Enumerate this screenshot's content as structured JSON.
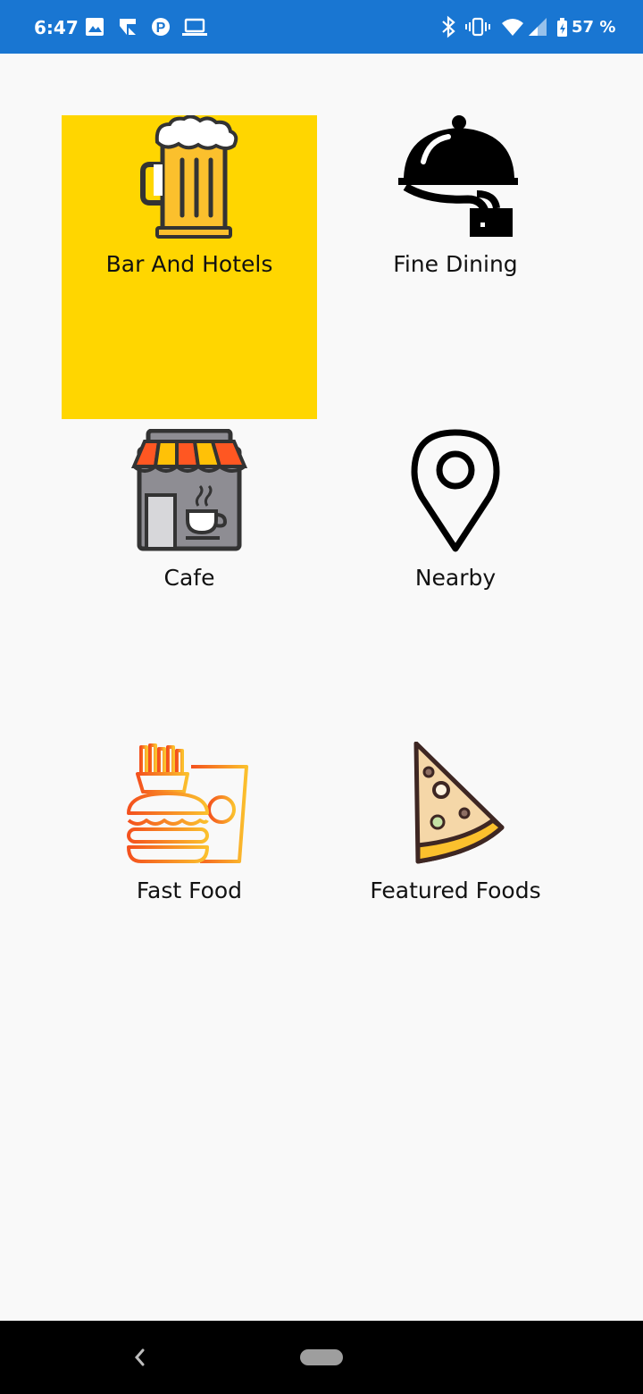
{
  "status_bar": {
    "time": "6:47",
    "battery_percent": "57 %",
    "background": "#1976d2",
    "left_icons": [
      "image-icon",
      "notification-icon",
      "parking-icon",
      "laptop-icon"
    ],
    "right_icons": [
      "bluetooth-icon",
      "vibrate-icon",
      "wifi-icon",
      "signal-icon",
      "battery-icon"
    ]
  },
  "categories": [
    {
      "label": "Bar And Hotels",
      "icon": "beer-mug-icon",
      "selected": true
    },
    {
      "label": "Fine Dining",
      "icon": "serving-cloche-icon",
      "selected": false
    },
    {
      "label": "Cafe",
      "icon": "cafe-storefront-icon",
      "selected": false
    },
    {
      "label": "Nearby",
      "icon": "location-pin-icon",
      "selected": false
    },
    {
      "label": "Fast Food",
      "icon": "fast-food-icon",
      "selected": false
    },
    {
      "label": "Featured Foods",
      "icon": "pizza-slice-icon",
      "selected": false
    }
  ],
  "colors": {
    "selected_tile": "#ffd600",
    "background": "#f9f9f9"
  }
}
